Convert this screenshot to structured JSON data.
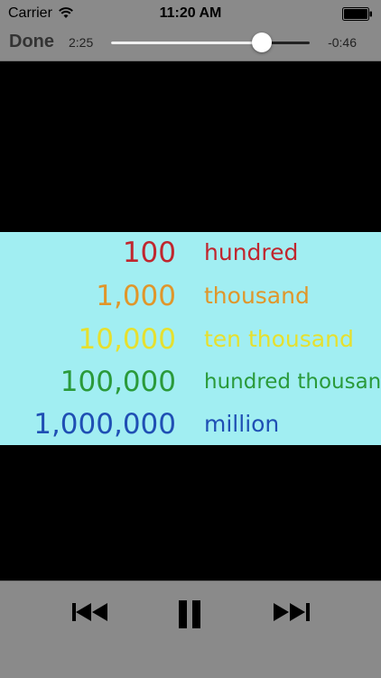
{
  "status_bar": {
    "carrier": "Carrier",
    "time": "11:20 AM",
    "wifi_icon": "wifi-icon",
    "battery_icon": "battery-icon"
  },
  "player": {
    "done_label": "Done",
    "elapsed": "2:25",
    "remaining": "-0:46",
    "progress_fraction": 0.76
  },
  "video": {
    "rows": [
      {
        "number": "100",
        "word": "hundred",
        "color": "#c0262e"
      },
      {
        "number": "1,000",
        "word": "thousand",
        "color": "#e0962a"
      },
      {
        "number": "10,000",
        "word": "ten thousand",
        "color": "#e6e02e"
      },
      {
        "number": "100,000",
        "word": "hundred thousand",
        "color": "#2a9a3a"
      },
      {
        "number": "1,000,000",
        "word": "million",
        "color": "#1f4fb4"
      }
    ],
    "background_color": "#a1eef2"
  },
  "controls": {
    "rewind_icon": "rewind-icon",
    "pause_icon": "pause-icon",
    "fast_forward_icon": "fast-forward-icon"
  }
}
